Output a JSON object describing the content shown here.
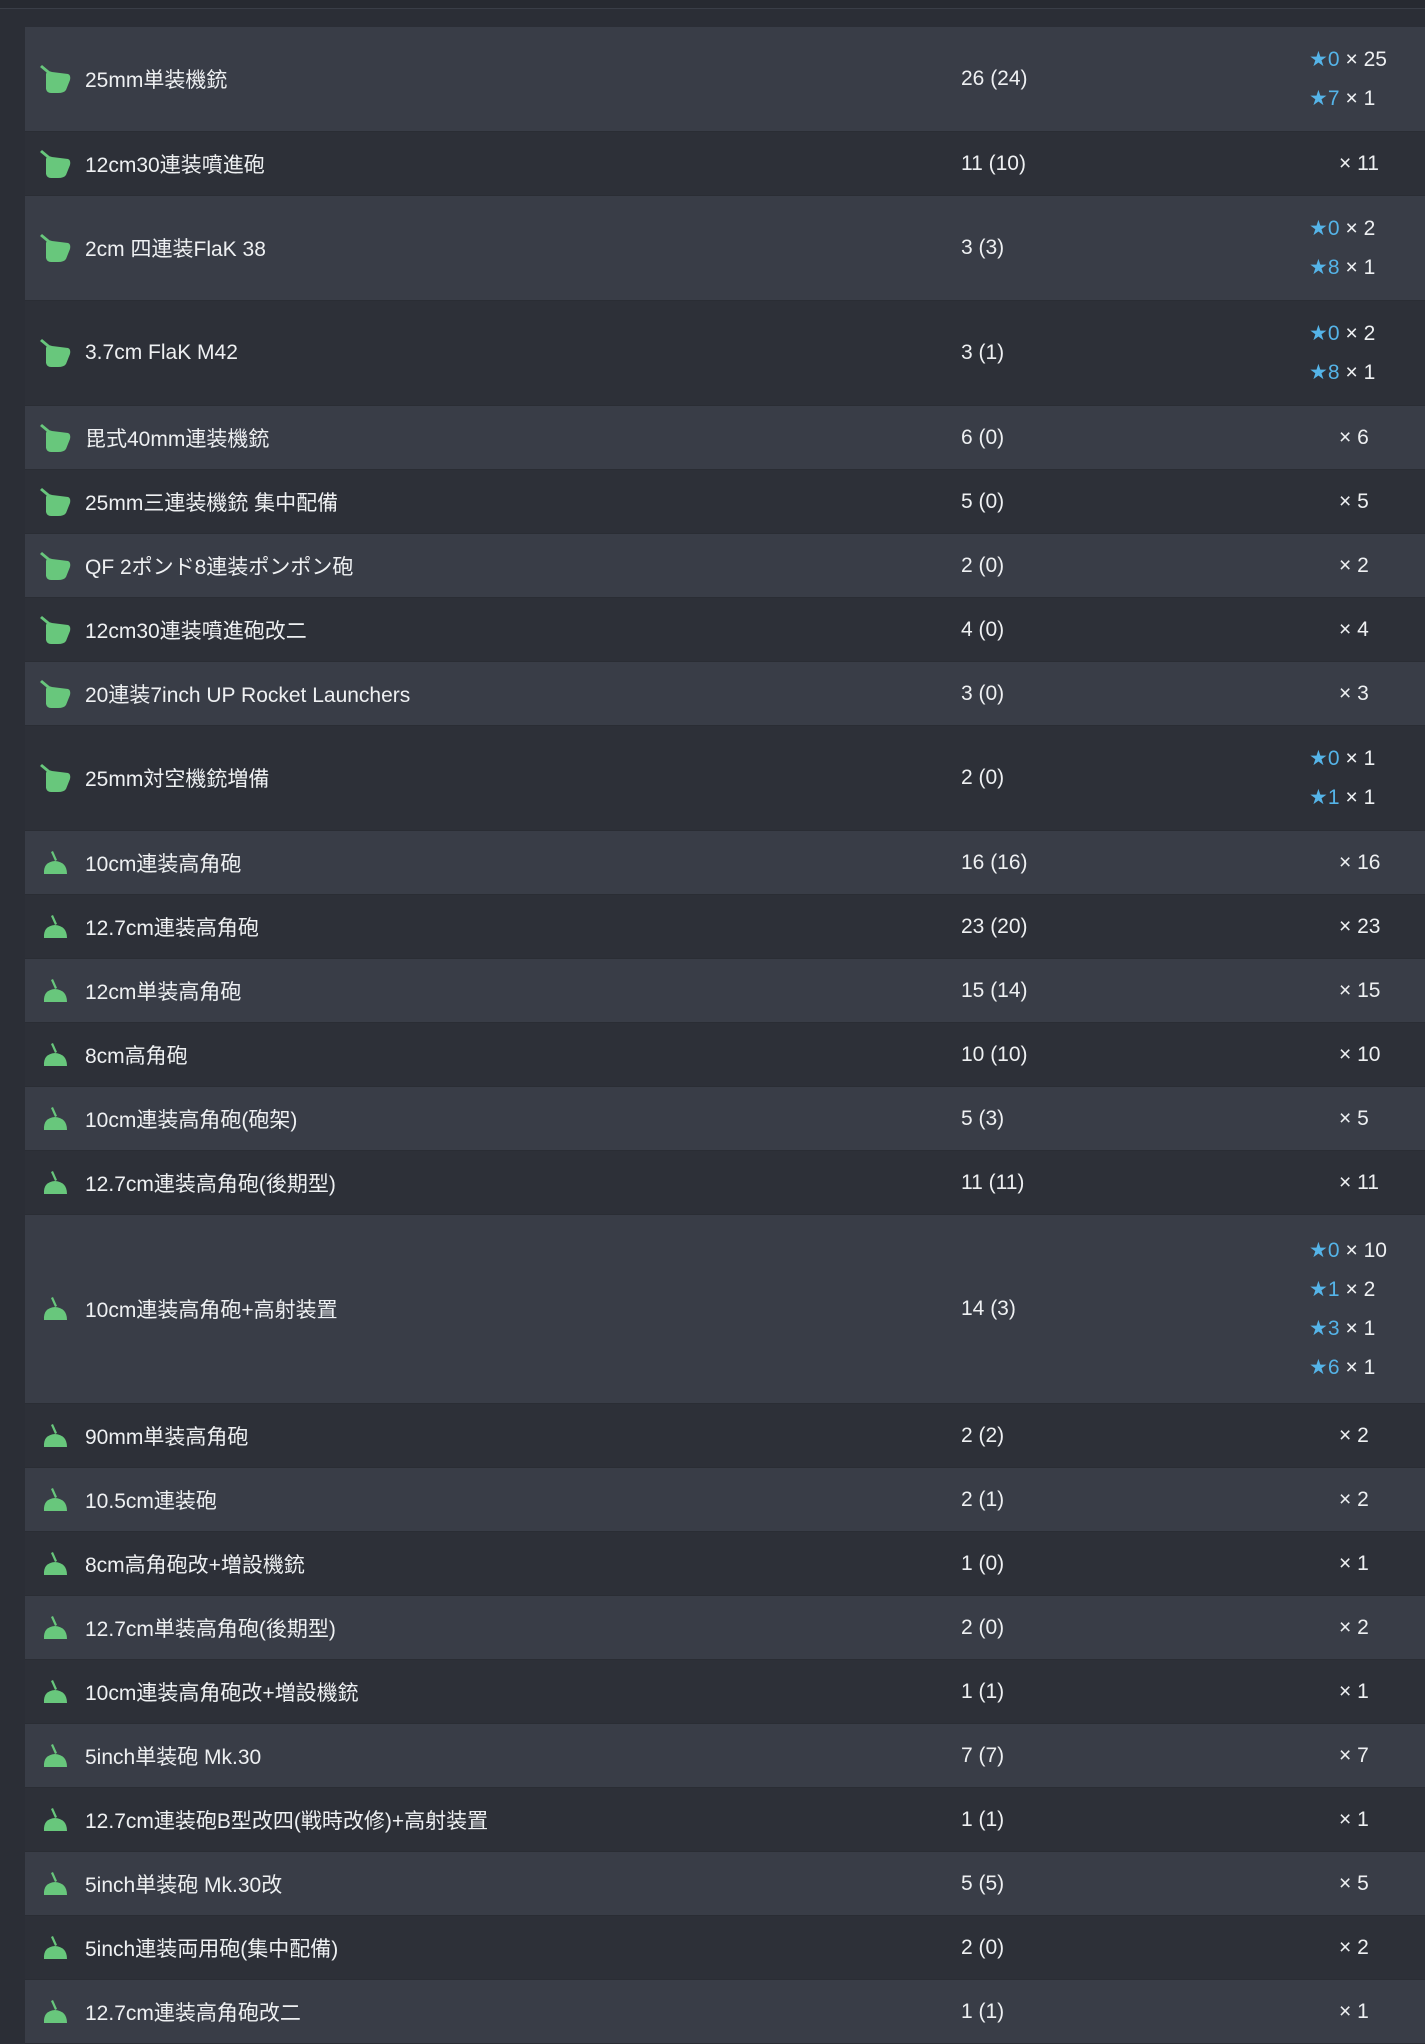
{
  "colors": {
    "icon_green": "#68c77c",
    "star_blue": "#55b4e8",
    "row_light": "#393d47",
    "row_dark": "#2d3038"
  },
  "rows": [
    {
      "icon": "aa-gun-icon",
      "name": "25mm単装機銃",
      "count": "26 (24)",
      "stars": [
        {
          "star": "★0",
          "times": "× 25"
        },
        {
          "star": "★7",
          "times": "× 1"
        }
      ]
    },
    {
      "icon": "aa-gun-icon",
      "name": "12cm30連装噴進砲",
      "count": "11 (10)",
      "stars": [
        {
          "star": "",
          "times": "× 11"
        }
      ]
    },
    {
      "icon": "aa-gun-icon",
      "name": "2cm 四連装FlaK 38",
      "count": "3 (3)",
      "stars": [
        {
          "star": "★0",
          "times": "× 2"
        },
        {
          "star": "★8",
          "times": "× 1"
        }
      ]
    },
    {
      "icon": "aa-gun-icon",
      "name": "3.7cm FlaK M42",
      "count": "3 (1)",
      "stars": [
        {
          "star": "★0",
          "times": "× 2"
        },
        {
          "star": "★8",
          "times": "× 1"
        }
      ]
    },
    {
      "icon": "aa-gun-icon",
      "name": "毘式40mm連装機銃",
      "count": "6 (0)",
      "stars": [
        {
          "star": "",
          "times": "× 6"
        }
      ]
    },
    {
      "icon": "aa-gun-icon",
      "name": "25mm三連装機銃 集中配備",
      "count": "5 (0)",
      "stars": [
        {
          "star": "",
          "times": "× 5"
        }
      ]
    },
    {
      "icon": "aa-gun-icon",
      "name": "QF 2ポンド8連装ポンポン砲",
      "count": "2 (0)",
      "stars": [
        {
          "star": "",
          "times": "× 2"
        }
      ]
    },
    {
      "icon": "aa-gun-icon",
      "name": "12cm30連装噴進砲改二",
      "count": "4 (0)",
      "stars": [
        {
          "star": "",
          "times": "× 4"
        }
      ]
    },
    {
      "icon": "aa-gun-icon",
      "name": "20連装7inch UP Rocket Launchers",
      "count": "3 (0)",
      "stars": [
        {
          "star": "",
          "times": "× 3"
        }
      ]
    },
    {
      "icon": "aa-gun-icon",
      "name": "25mm対空機銃増備",
      "count": "2 (0)",
      "stars": [
        {
          "star": "★0",
          "times": "× 1"
        },
        {
          "star": "★1",
          "times": "× 1"
        }
      ]
    },
    {
      "icon": "ha-gun-icon",
      "name": "10cm連装高角砲",
      "count": "16 (16)",
      "stars": [
        {
          "star": "",
          "times": "× 16"
        }
      ]
    },
    {
      "icon": "ha-gun-icon",
      "name": "12.7cm連装高角砲",
      "count": "23 (20)",
      "stars": [
        {
          "star": "",
          "times": "× 23"
        }
      ]
    },
    {
      "icon": "ha-gun-icon",
      "name": "12cm単装高角砲",
      "count": "15 (14)",
      "stars": [
        {
          "star": "",
          "times": "× 15"
        }
      ]
    },
    {
      "icon": "ha-gun-icon",
      "name": "8cm高角砲",
      "count": "10 (10)",
      "stars": [
        {
          "star": "",
          "times": "× 10"
        }
      ]
    },
    {
      "icon": "ha-gun-icon",
      "name": "10cm連装高角砲(砲架)",
      "count": "5 (3)",
      "stars": [
        {
          "star": "",
          "times": "× 5"
        }
      ]
    },
    {
      "icon": "ha-gun-icon",
      "name": "12.7cm連装高角砲(後期型)",
      "count": "11 (11)",
      "stars": [
        {
          "star": "",
          "times": "× 11"
        }
      ]
    },
    {
      "icon": "ha-gun-icon",
      "name": "10cm連装高角砲+高射装置",
      "count": "14 (3)",
      "stars": [
        {
          "star": "★0",
          "times": "× 10"
        },
        {
          "star": "★1",
          "times": "× 2"
        },
        {
          "star": "★3",
          "times": "× 1"
        },
        {
          "star": "★6",
          "times": "× 1"
        }
      ]
    },
    {
      "icon": "ha-gun-icon",
      "name": "90mm単装高角砲",
      "count": "2 (2)",
      "stars": [
        {
          "star": "",
          "times": "× 2"
        }
      ]
    },
    {
      "icon": "ha-gun-icon",
      "name": "10.5cm連装砲",
      "count": "2 (1)",
      "stars": [
        {
          "star": "",
          "times": "× 2"
        }
      ]
    },
    {
      "icon": "ha-gun-icon",
      "name": "8cm高角砲改+増設機銃",
      "count": "1 (0)",
      "stars": [
        {
          "star": "",
          "times": "× 1"
        }
      ]
    },
    {
      "icon": "ha-gun-icon",
      "name": "12.7cm単装高角砲(後期型)",
      "count": "2 (0)",
      "stars": [
        {
          "star": "",
          "times": "× 2"
        }
      ]
    },
    {
      "icon": "ha-gun-icon",
      "name": "10cm連装高角砲改+増設機銃",
      "count": "1 (1)",
      "stars": [
        {
          "star": "",
          "times": "× 1"
        }
      ]
    },
    {
      "icon": "ha-gun-icon",
      "name": "5inch単装砲 Mk.30",
      "count": "7 (7)",
      "stars": [
        {
          "star": "",
          "times": "× 7"
        }
      ]
    },
    {
      "icon": "ha-gun-icon",
      "name": "12.7cm連装砲B型改四(戦時改修)+高射装置",
      "count": "1 (1)",
      "stars": [
        {
          "star": "",
          "times": "× 1"
        }
      ]
    },
    {
      "icon": "ha-gun-icon",
      "name": "5inch単装砲 Mk.30改",
      "count": "5 (5)",
      "stars": [
        {
          "star": "",
          "times": "× 5"
        }
      ]
    },
    {
      "icon": "ha-gun-icon",
      "name": "5inch連装両用砲(集中配備)",
      "count": "2 (0)",
      "stars": [
        {
          "star": "",
          "times": "× 2"
        }
      ]
    },
    {
      "icon": "ha-gun-icon",
      "name": "12.7cm連装高角砲改二",
      "count": "1 (1)",
      "stars": [
        {
          "star": "",
          "times": "× 1"
        }
      ]
    }
  ]
}
